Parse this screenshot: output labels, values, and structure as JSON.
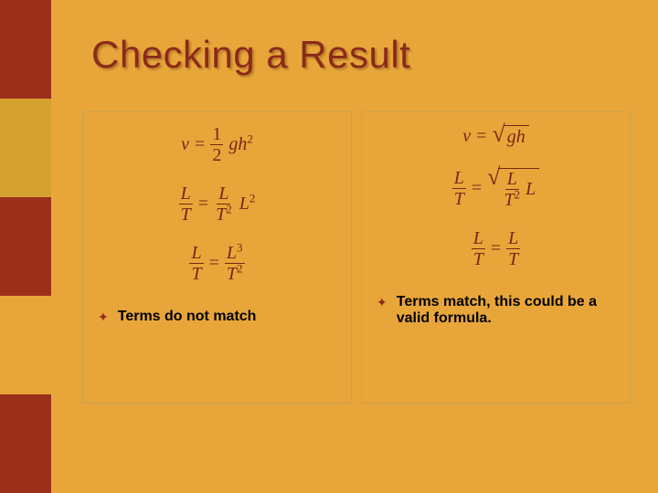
{
  "title": "Checking a Result",
  "left": {
    "eq1_lhs_var": "v",
    "eq1_frac_num": "1",
    "eq1_frac_den": "2",
    "eq1_rhs_base": "gh",
    "eq1_rhs_exp": "2",
    "eq2_l_num": "L",
    "eq2_l_den": "T",
    "eq2_r_num": "L",
    "eq2_r_den_base": "T",
    "eq2_r_den_exp": "2",
    "eq2_tail_base": "L",
    "eq2_tail_exp": "2",
    "eq3_l_num": "L",
    "eq3_l_den": "T",
    "eq3_r_num_base": "L",
    "eq3_r_num_exp": "3",
    "eq3_r_den_base": "T",
    "eq3_r_den_exp": "2",
    "caption": "Terms do not match"
  },
  "right": {
    "eq1_lhs_var": "v",
    "eq1_sqrt_body": "gh",
    "eq2_l_num": "L",
    "eq2_l_den": "T",
    "eq2_sqrt_num": "L",
    "eq2_sqrt_den_base": "T",
    "eq2_sqrt_den_exp": "2",
    "eq2_tail": "L",
    "eq3_l_num": "L",
    "eq3_l_den": "T",
    "eq3_r_num": "L",
    "eq3_r_den": "T",
    "caption": "Terms match, this could be a valid formula."
  }
}
